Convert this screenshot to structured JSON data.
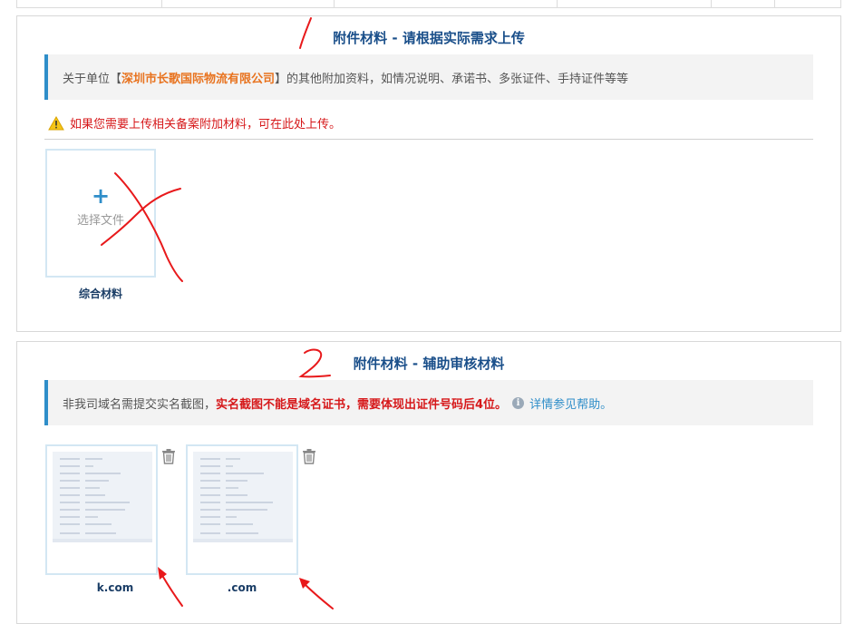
{
  "section1": {
    "title": "附件材料 - 请根据实际需求上传",
    "notice_prefix": "关于单位【",
    "org_name": "深圳市长歌国际物流有限公司",
    "notice_suffix": "】的其他附加资料，如情况说明、承诺书、多张证件、手持证件等等",
    "warning": "如果您需要上传相关备案附加材料，可在此处上传。",
    "upload_plus": "+",
    "upload_label": "选择文件",
    "caption": "综合材料",
    "annotation_number": "1"
  },
  "section2": {
    "title": "附件材料 - 辅助审核材料",
    "notice_plain": "非我司域名需提交实名截图，",
    "notice_bold": "实名截图不能是域名证书，需要体现出证件号码后4位。",
    "help_link": "详情参见帮助。",
    "thumbs": [
      {
        "caption": "k.com"
      },
      {
        "caption": ".com"
      }
    ],
    "annotation_number": "2"
  },
  "colors": {
    "title": "#1a4f8a",
    "accent": "#2f8ec9",
    "warning": "#d6181a",
    "org": "#e8731f",
    "annotation": "#e8191b"
  },
  "icons": {
    "warning": "warning-triangle-icon",
    "info": "info-circle-icon",
    "trash": "trash-icon",
    "plus": "plus-icon"
  }
}
